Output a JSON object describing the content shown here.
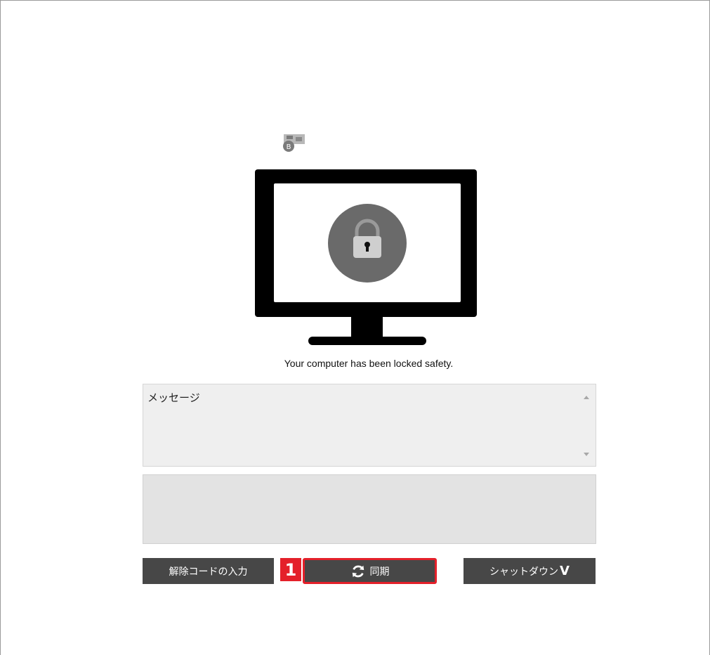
{
  "status_message": "Your computer has been locked safety.",
  "message_box": {
    "label": "メッセージ"
  },
  "buttons": {
    "unlock_code_label": "解除コードの入力",
    "sync_label": "同期",
    "shutdown_label": "シャットダウン",
    "shutdown_chevron": "V"
  },
  "annotation": {
    "number": "1"
  },
  "icons": {
    "brand": "brand-logo-icon",
    "monitor": "monitor-icon",
    "lock": "padlock-icon",
    "sync": "sync-icon"
  },
  "colors": {
    "button_bg": "#474747",
    "highlight": "#e4202a",
    "lock_circle": "#6a6a6a",
    "panel_bg": "#e3e3e3"
  }
}
